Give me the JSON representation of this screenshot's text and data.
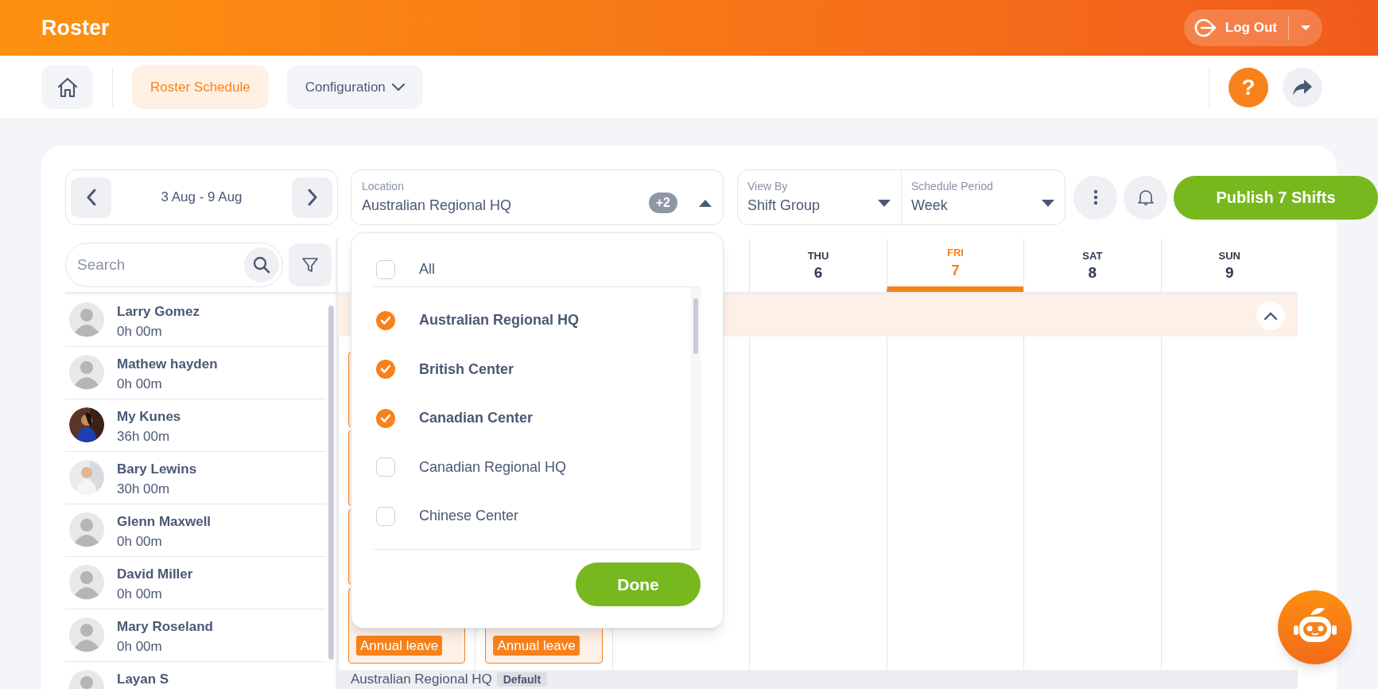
{
  "app": {
    "title": "Roster",
    "logout": "Log Out"
  },
  "nav": [
    {
      "label": "Roster Schedule",
      "selected": true,
      "dropdown": false
    },
    {
      "label": "Configuration",
      "selected": false,
      "dropdown": true
    }
  ],
  "help": "?",
  "date_range": "3 Aug - 9 Aug",
  "location": {
    "label": "Location",
    "value": "Australian Regional HQ",
    "extra": "+2",
    "expanded": true
  },
  "view_by": {
    "label": "View By",
    "value": "Shift Group"
  },
  "schedule_period": {
    "label": "Schedule Period",
    "value": "Week"
  },
  "publish": "Publish 7 Shifts",
  "search": {
    "placeholder": "Search"
  },
  "employees": [
    {
      "name": "Larry Gomez",
      "hours": "0h 00m",
      "kind": "default"
    },
    {
      "name": "Mathew hayden",
      "hours": "0h 00m",
      "kind": "default"
    },
    {
      "name": "My Kunes",
      "hours": "36h 00m"
    },
    {
      "name": "Bary Lewins",
      "hours": "30h 00m"
    },
    {
      "name": "Glenn Maxwell",
      "hours": "0h 00m",
      "kind": "default"
    },
    {
      "name": "David Miller",
      "hours": "0h 00m",
      "kind": "default"
    },
    {
      "name": "Mary Roseland",
      "hours": "0h 00m",
      "kind": "default"
    },
    {
      "name": "Layan S",
      "kind": "default"
    }
  ],
  "days": [
    {
      "weekday": "THU",
      "date": "6",
      "selected": false
    },
    {
      "weekday": "FRI",
      "date": "7",
      "selected": true
    },
    {
      "weekday": "SAT",
      "date": "8",
      "selected": false
    },
    {
      "weekday": "SUN",
      "date": "9",
      "selected": false
    }
  ],
  "leave_badges": [
    "Annual leave",
    "Annual leave"
  ],
  "next_group": {
    "name": "Australian Regional HQ",
    "badge": "Default"
  },
  "location_menu": {
    "all": {
      "label": "All",
      "checked": false
    },
    "options": [
      {
        "label": "Australian Regional HQ",
        "checked": true
      },
      {
        "label": "British Center",
        "checked": true
      },
      {
        "label": "Canadian Center",
        "checked": true
      },
      {
        "label": "Canadian Regional HQ",
        "checked": false
      },
      {
        "label": "Chinese Center",
        "checked": false
      }
    ],
    "done": "Done"
  }
}
